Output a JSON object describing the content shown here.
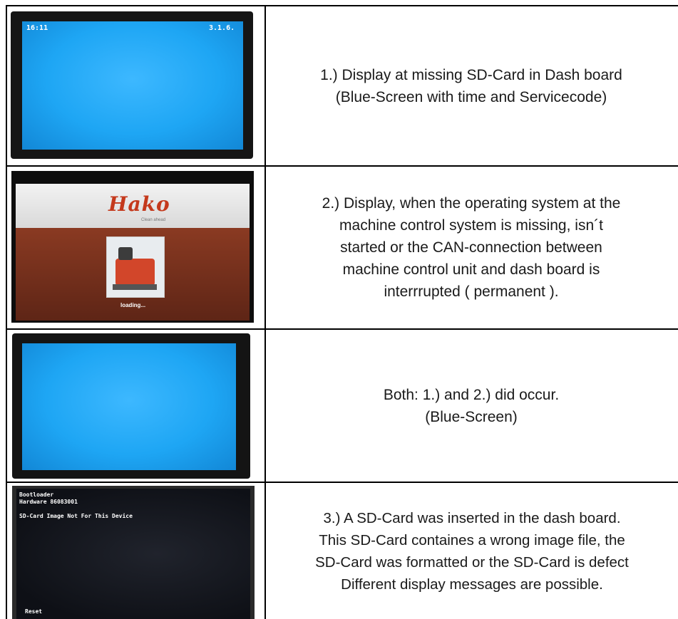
{
  "rows": [
    {
      "screen": {
        "time": "16:11",
        "service_code": "3.1.6."
      },
      "lines": [
        "1.) Display at missing SD-Card in Dash board",
        "(Blue-Screen with time and Servicecode)"
      ]
    },
    {
      "screen": {
        "brand": "Hako",
        "tagline": "Clean ahead",
        "status": "loading..."
      },
      "lines": [
        "2.) Display, when the operating system at the",
        "machine control system is missing, isn´t",
        "started or the CAN-connection between",
        "machine control unit and dash board is",
        "interrrupted ( permanent )."
      ]
    },
    {
      "screen": {},
      "lines": [
        "Both: 1.) and 2.) did occur.",
        "(Blue-Screen)"
      ]
    },
    {
      "screen": {
        "line1": "Bootloader",
        "line2": "Hardware 86083001",
        "line3": "SD-Card Image Not For This Device",
        "footer": "Reset"
      },
      "lines": [
        "3.) A SD-Card was inserted in the dash board.",
        "This SD-Card containes a wrong image file, the",
        "SD-Card was formatted or the SD-Card is defect",
        "Different display messages are possible."
      ]
    }
  ],
  "colors": {
    "border": "#000000",
    "screen_blue": "#1ea6f4",
    "brand_red": "#c4391c",
    "brown": "#7a2f1c"
  }
}
